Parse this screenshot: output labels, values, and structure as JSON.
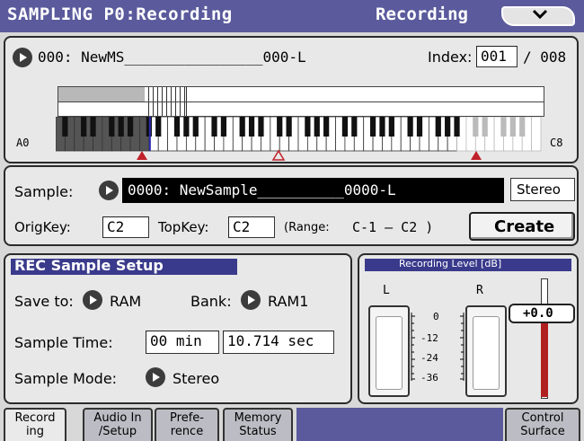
{
  "title_bar": {
    "title": "SAMPLING P0:Recording",
    "page": "Recording",
    "menu_glyph": "⌄"
  },
  "multisample": {
    "name": "000: NewMS________________000-L",
    "index_label": "Index:",
    "index_value": "001",
    "index_total": "/ 008",
    "key_low_label": "A0",
    "key_high_label": "C8"
  },
  "sample": {
    "label": "Sample:",
    "name": "0000: NewSample__________0000-L",
    "mode_badge": "Stereo",
    "orig_key_label": "OrigKey:",
    "orig_key_value": "C2",
    "top_key_label": "TopKey:",
    "top_key_value": "C2",
    "range_label": "(Range:",
    "range_value": "C-1 – C2 )",
    "create_label": "Create"
  },
  "rec_setup": {
    "title": "REC Sample Setup",
    "save_to_label": "Save to:",
    "save_to_value": "RAM",
    "bank_label": "Bank:",
    "bank_value": "RAM1",
    "sample_time_label": "Sample Time:",
    "sample_time_min": "00 min",
    "sample_time_sec": "10.714 sec",
    "sample_mode_label": "Sample Mode:",
    "sample_mode_value": "Stereo"
  },
  "rec_level": {
    "title": "Recording Level [dB]",
    "left_label": "L",
    "right_label": "R",
    "scale": [
      "0",
      "-12",
      "-24",
      "-36"
    ],
    "level_value": "+0.0",
    "fader_fraction": 0.72
  },
  "tabs": [
    {
      "line1": "Record",
      "line2": "ing"
    },
    {
      "line1": "Audio In",
      "line2": "/Setup"
    },
    {
      "line1": "Prefe-",
      "line2": "rence"
    },
    {
      "line1": "Memory",
      "line2": "Status"
    },
    {
      "line1": "Control",
      "line2": "Surface"
    }
  ],
  "colors": {
    "title_bar": "#5a5a9c",
    "section_header": "#3a3a8c",
    "black_field": "#000000",
    "fader_red": "#b02020",
    "key_marker_red": "#c0202a"
  }
}
